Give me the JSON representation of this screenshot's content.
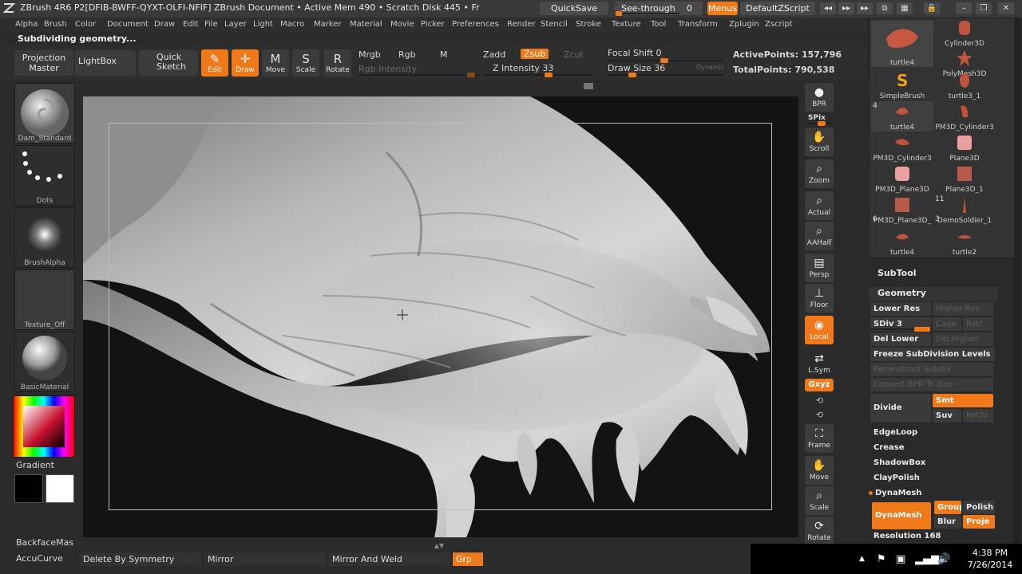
{
  "titlebar": {
    "app_title": "ZBrush 4R6  P2[DFIB-BWFF-QYXT-OLFI-NFIF]    ZBrush Document    • Active Mem 490  • Scratch Disk 445  • Fr",
    "quicksave": "QuickSave",
    "seethrough_label": "See-through",
    "seethrough_value": "0",
    "menus": "Menus",
    "default_zscript": "DefaultZScript",
    "colors": {
      "bar": "#393939",
      "accent": "#f07a1a"
    }
  },
  "menubar": [
    "Alpha",
    "Brush",
    "Color",
    "Document",
    "Draw",
    "Edit",
    "File",
    "Layer",
    "Light",
    "Macro",
    "Marker",
    "Material",
    "Movie",
    "Picker",
    "Preferences",
    "Render",
    "Stencil",
    "Stroke",
    "Texture",
    "Tool",
    "Transform",
    "Zplugin",
    "Zscript"
  ],
  "status": "Subdividing geometry...",
  "toolbar": {
    "projection_master": [
      "Projection",
      "Master"
    ],
    "lightbox": "LightBox",
    "quick_sketch": [
      "Quick",
      "Sketch"
    ],
    "edit": "Edit",
    "draw": "Draw",
    "move": "Move",
    "scale": "Scale",
    "rotate": "Rotate",
    "mrgb": "Mrgb",
    "rgb": "Rgb",
    "m": "M",
    "rgb_intensity": "Rgb Intensity",
    "zadd": "Zadd",
    "zsub": "Zsub",
    "zcut": "Zcut",
    "z_intensity_label": "Z Intensity",
    "z_intensity_value": "33",
    "focal_shift_label": "Focal Shift",
    "focal_shift_value": "0",
    "draw_size_label": "Draw Size",
    "draw_size_value": "36",
    "dynamic": "Dynamic",
    "active_points_label": "ActivePoints:",
    "active_points_value": "157,796",
    "total_points_label": "TotalPoints:",
    "total_points_value": "790,538"
  },
  "left_shelf": {
    "brush": "Dam_Standard",
    "stroke": "Dots",
    "alpha": "BrushAlpha",
    "texture": "Texture_Off",
    "material": "BasicMaterial",
    "gradient": "Gradient",
    "backface": "BackfaceMas",
    "accucurve": "AccuCurve"
  },
  "nav": {
    "bpr": "BPR",
    "spix": "SPix",
    "scroll": "Scroll",
    "zoom": "Zoom",
    "actual": "Actual",
    "aahalf": "AAHalf",
    "persp": "Persp",
    "floor": "Floor",
    "local": "Local",
    "lsym": "L.Sym",
    "xyz": "Gxyz",
    "frame": "Frame",
    "move": "Move",
    "scale": "Scale",
    "rotate": "Rotate"
  },
  "subtools_grid": [
    {
      "label": "turtle4",
      "count": ""
    },
    {
      "label": "Cylinder3D",
      "count": ""
    },
    {
      "label": "PolyMesh3D",
      "count": ""
    },
    {
      "label": "SimpleBrush",
      "count": ""
    },
    {
      "label": "turtle3_1",
      "count": ""
    },
    {
      "label": "turtle4",
      "count": "4"
    },
    {
      "label": "PM3D_Cylinder3",
      "count": ""
    },
    {
      "label": "PM3D_Cylinder3",
      "count": ""
    },
    {
      "label": "Plane3D",
      "count": ""
    },
    {
      "label": "PM3D_Plane3D",
      "count": ""
    },
    {
      "label": "Plane3D_1",
      "count": ""
    },
    {
      "label": "PM3D_Plane3D_",
      "count": "6"
    },
    {
      "label": "DemoSoldier_1",
      "count": "11"
    },
    {
      "label": "turtle4",
      "count": ""
    },
    {
      "label": "turtle2",
      "count": "3"
    }
  ],
  "geometry_panel": {
    "subtool_title": "SubTool",
    "geometry_title": "Geometry",
    "lower_res": "Lower Res",
    "higher_res": "Higher Res",
    "sdiv_label": "SDiv",
    "sdiv_value": "3",
    "cage": "Cage",
    "rstr": "Rstr",
    "del_lower": "Del Lower",
    "del_higher": "Del Higher",
    "freeze": "Freeze SubDivision Levels",
    "reconstruct": "Reconstruct Subdiv",
    "convert_bpr": "Convert BPR To Geo",
    "divide": "Divide",
    "smt": "Smt",
    "suv": "Suv",
    "reuv": "ReUV",
    "edgeloop": "EdgeLoop",
    "crease": "Crease",
    "shadowbox": "ShadowBox",
    "claypolish": "ClayPolish",
    "dynamesh_title": "DynaMesh",
    "dynamesh_btn": "DynaMesh",
    "group": "Group",
    "polish": "Polish",
    "blur": "Blur",
    "project": "Proje",
    "resolution_label": "Resolution",
    "resolution_value": "168"
  },
  "bottom": {
    "delete_by_symmetry": "Delete By Symmetry",
    "mirror": "Mirror",
    "mirror_and_weld": "Mirror And Weld",
    "grp": "Grp"
  },
  "taskbar": {
    "time": "4:38 PM",
    "date": "7/26/2014"
  }
}
